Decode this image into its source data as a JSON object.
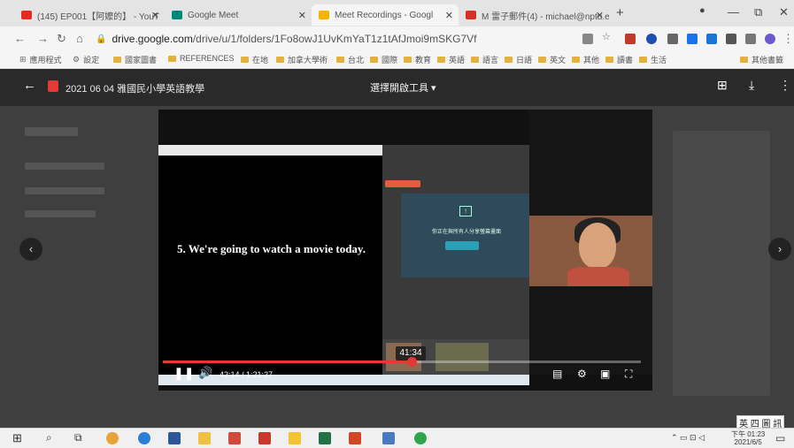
{
  "browser": {
    "tabs": [
      {
        "title": "(145) EP001【阿嬤的】 - YouT",
        "favicon": "youtube",
        "color": "#e02b20"
      },
      {
        "title": "Google Meet",
        "favicon": "meet",
        "color": "#00897b"
      },
      {
        "title": "Meet Recordings - Googl",
        "favicon": "drive",
        "color": "#f4b400"
      },
      {
        "title": "M 雷子郵件(4) - michael@nptu.edu",
        "favicon": "gmail",
        "color": "#d93025"
      }
    ],
    "new_tab_label": "+",
    "window_controls": {
      "minimize": "—",
      "restore": "⧉",
      "close": "✕"
    }
  },
  "address_bar": {
    "domain": "drive.google.com",
    "path": "/drive/u/1/folders/1Fo8owJ1UvKmYaT1z1tAfJmoi9mSKG7Vf"
  },
  "bookmarks": [
    "應用程式",
    "設定",
    "國家圖書",
    "REFERENCES",
    "在地",
    "加拿大學術",
    "台北",
    "國際",
    "教育",
    "英語",
    "語言",
    "日語",
    "英文",
    "其他",
    "讀書",
    "生活"
  ],
  "bookmarks_other": "其他書籤",
  "viewer": {
    "title": "2021 06 04 雅國民小學英語教學",
    "open_with": "選擇開啟工具 ▾",
    "subtitle": "5. We're going to watch a movie today.",
    "tooltip_time": "41:34",
    "timecode": "42:14 / 1:21:27",
    "progress": 0.52,
    "share_text": "你正在與所有人分享螢幕畫面"
  },
  "taskbar": {
    "time": "下午 01:23",
    "date": "2021/6/5",
    "ime": "英 四 圖 訊"
  },
  "colors": {
    "accent": "#e53935",
    "viewer_bg": "#3f3f3f"
  }
}
